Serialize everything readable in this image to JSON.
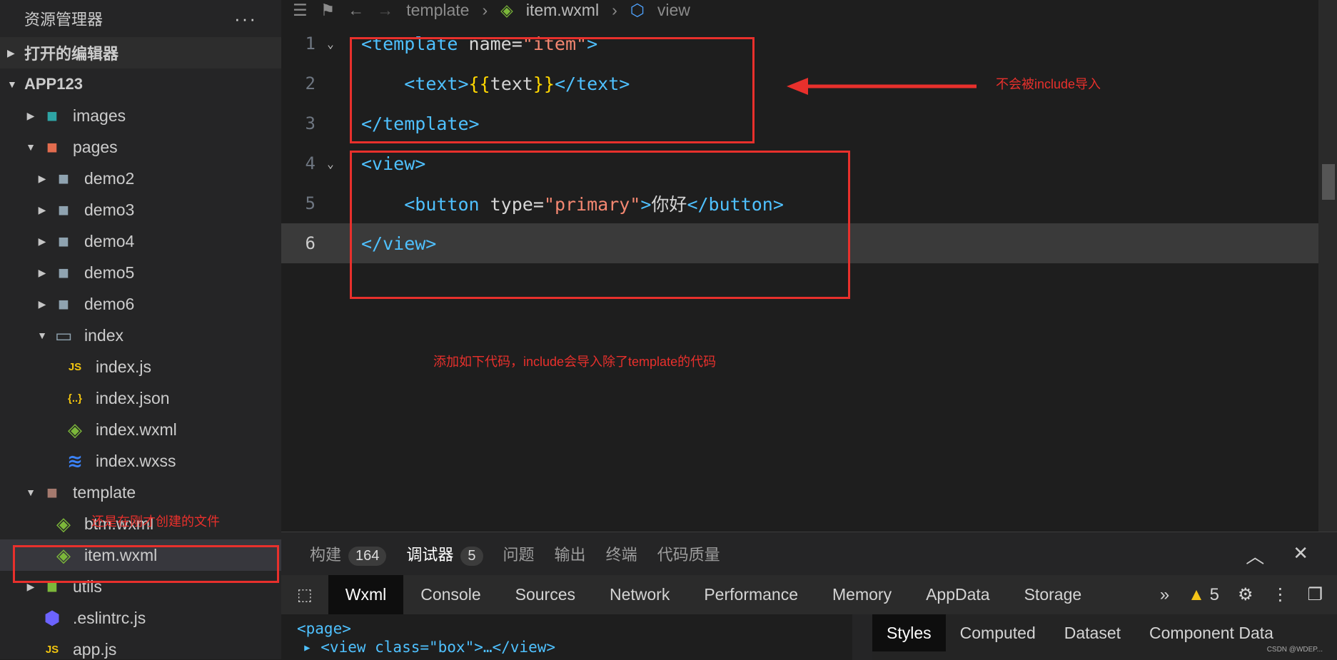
{
  "sidebar": {
    "title": "资源管理器",
    "more": "···",
    "sections": [
      {
        "label": "打开的编辑器"
      },
      {
        "label": "APP123"
      }
    ],
    "items": [
      {
        "label": "images",
        "icon": "images-folder-icon",
        "color": "#2ea4a4"
      },
      {
        "label": "pages",
        "icon": "pages-folder-icon",
        "color": "#e26c4e"
      },
      {
        "label": "demo2",
        "icon": "folder-icon",
        "color": "#8fa3b0"
      },
      {
        "label": "demo3",
        "icon": "folder-icon",
        "color": "#8fa3b0"
      },
      {
        "label": "demo4",
        "icon": "folder-icon",
        "color": "#8fa3b0"
      },
      {
        "label": "demo5",
        "icon": "folder-icon",
        "color": "#8fa3b0"
      },
      {
        "label": "demo6",
        "icon": "folder-icon",
        "color": "#8fa3b0"
      },
      {
        "label": "index",
        "icon": "folder-open-icon",
        "color": "#8fa3b0"
      },
      {
        "label": "index.js",
        "icon": "js-file-icon",
        "color": "#f1c40f"
      },
      {
        "label": "index.json",
        "icon": "json-file-icon",
        "color": "#f1c40f"
      },
      {
        "label": "index.wxml",
        "icon": "wxml-file-icon",
        "color": "#7cb83a"
      },
      {
        "label": "index.wxss",
        "icon": "wxss-file-icon",
        "color": "#3b82f6"
      },
      {
        "label": "template",
        "icon": "template-folder-icon",
        "color": "#a57a6e"
      },
      {
        "label": "btm.wxml",
        "icon": "wxml-file-icon",
        "color": "#7cb83a"
      },
      {
        "label": "item.wxml",
        "icon": "wxml-file-icon",
        "color": "#7cb83a"
      },
      {
        "label": "utils",
        "icon": "utils-folder-icon",
        "color": "#7cb83a"
      },
      {
        "label": ".eslintrc.js",
        "icon": "eslint-file-icon",
        "color": "#6c63ff"
      },
      {
        "label": "app.js",
        "icon": "js-file-icon",
        "color": "#f1c40f"
      }
    ]
  },
  "breadcrumb": {
    "items": [
      "template",
      "item.wxml",
      "view"
    ]
  },
  "editor": {
    "lines": [
      {
        "num": "1",
        "parts": [
          [
            "tag",
            "<template"
          ],
          [
            "attr",
            " name="
          ],
          [
            "str",
            "\"item\""
          ],
          [
            "tag",
            ">"
          ]
        ]
      },
      {
        "num": "2",
        "parts": [
          [
            "txt",
            "    "
          ],
          [
            "tag",
            "<text>"
          ],
          [
            "brace",
            "{{"
          ],
          [
            "txt",
            "text"
          ],
          [
            "brace",
            "}}"
          ],
          [
            "tag",
            "</text>"
          ]
        ]
      },
      {
        "num": "3",
        "parts": [
          [
            "tag",
            "</template>"
          ]
        ]
      },
      {
        "num": "4",
        "parts": [
          [
            "tag",
            "<view>"
          ]
        ]
      },
      {
        "num": "5",
        "parts": [
          [
            "txt",
            "    "
          ],
          [
            "tag",
            "<button"
          ],
          [
            "attr",
            " type="
          ],
          [
            "str",
            "\"primary\""
          ],
          [
            "tag",
            ">"
          ],
          [
            "txt",
            "你好"
          ],
          [
            "tag",
            "</button>"
          ]
        ]
      },
      {
        "num": "6",
        "parts": [
          [
            "tag",
            "</view>"
          ]
        ]
      }
    ]
  },
  "annotations": {
    "arrow_note": "不会被include导入",
    "middle_note": "添加如下代码，include会导入除了template的代码",
    "sidebar_note": "还是在刚才创建的文件"
  },
  "panel": {
    "tabs": [
      {
        "label": "构建",
        "badge": "164"
      },
      {
        "label": "调试器",
        "badge": "5"
      },
      {
        "label": "问题"
      },
      {
        "label": "输出"
      },
      {
        "label": "终端"
      },
      {
        "label": "代码质量"
      }
    ],
    "collapse": "︿",
    "close": "✕"
  },
  "devtools": {
    "tabs": [
      "Wxml",
      "Console",
      "Sources",
      "Network",
      "Performance",
      "Memory",
      "AppData",
      "Storage"
    ],
    "more": "»",
    "warning_count": "5",
    "dom_lines": [
      "<page>",
      "▸ <view class=\"box\">…</view>"
    ],
    "styles_tabs": [
      "Styles",
      "Computed",
      "Dataset",
      "Component Data"
    ]
  },
  "watermark": "CSDN @WDEP..."
}
